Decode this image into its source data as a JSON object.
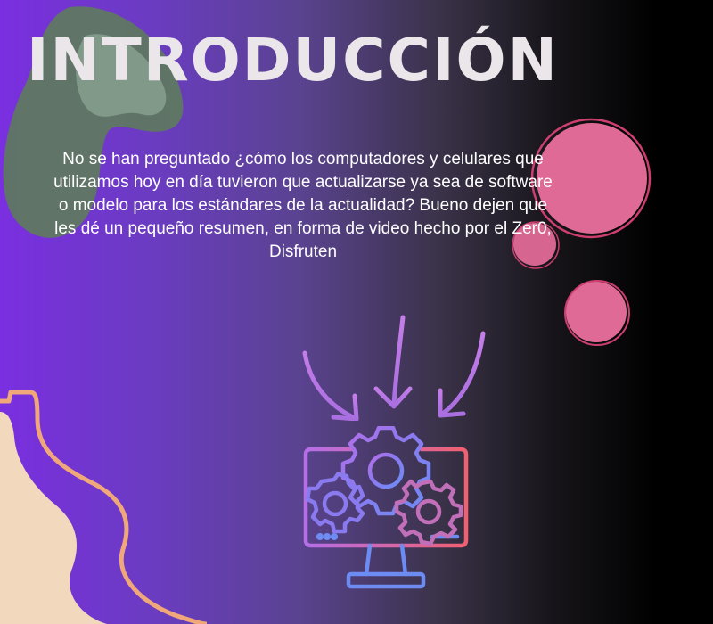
{
  "slide": {
    "title": "INTRODUCCIÓN",
    "body": "No se han preguntado ¿cómo los computadores y celulares que utilizamos hoy en día tuvieron que actualizarse ya sea de software o modelo para los estándares de la actualidad? Bueno dejen que les dé un pequeño resumen, en forma de video hecho por el Zer0, Disfruten"
  },
  "colors": {
    "title": "#ebe6ea",
    "body_text": "#ffffff",
    "blob_green": "#5e7a5e",
    "blob_sand": "#f2d8bd",
    "outline_orange": "#f0a77a",
    "circle_pink": "#e06a96",
    "circle_outline": "#cc3f6e",
    "icon_purple": "#b66ee8",
    "icon_blue": "#6c8cf3",
    "icon_red": "#f06070"
  },
  "icons": [
    "arrows-down-icon",
    "monitor-gears-icon"
  ]
}
